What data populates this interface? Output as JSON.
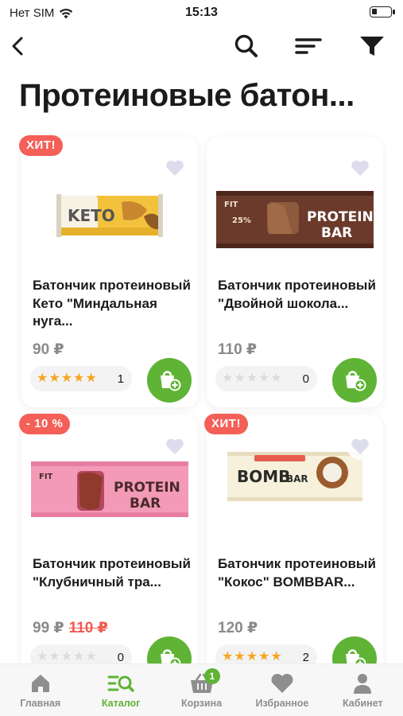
{
  "status_bar": {
    "carrier": "Нет SIM",
    "time": "15:13"
  },
  "nav": {
    "icons": [
      "back-arrow-icon",
      "search-icon",
      "sort-icon",
      "filter-icon"
    ]
  },
  "page": {
    "title": "Протеиновые батон..."
  },
  "colors": {
    "accent": "#5fb335",
    "badge": "#f45f58",
    "star": "#f5a623",
    "old_price": "#f15a50"
  },
  "products": [
    {
      "badge": "ХИТ!",
      "name": "Батончик протеиновый Кето \"Миндальная нуга...",
      "price": "90 ₽",
      "old_price": "",
      "rating": 5,
      "reviews": "1"
    },
    {
      "badge": "",
      "name": "Батончик протеиновый \"Двойной шокола...",
      "price": "110 ₽",
      "old_price": "",
      "rating": 0,
      "reviews": "0"
    },
    {
      "badge": "- 10 %",
      "name": "Батончик протеиновый \"Клубничный тра...",
      "price": "99 ₽",
      "old_price": "110 ₽",
      "rating": 0,
      "reviews": "0"
    },
    {
      "badge": "ХИТ!",
      "name": "Батончик протеиновый \"Кокос\" BOMBBAR...",
      "price": "120 ₽",
      "old_price": "",
      "rating": 5,
      "reviews": "2"
    }
  ],
  "tab_bar": {
    "tabs": [
      {
        "label": "Главная",
        "icon": "home-icon"
      },
      {
        "label": "Каталог",
        "icon": "catalog-search-icon"
      },
      {
        "label": "Корзина",
        "icon": "basket-icon"
      },
      {
        "label": "Избранное",
        "icon": "heart-icon"
      },
      {
        "label": "Кабинет",
        "icon": "profile-icon"
      }
    ],
    "cart_count": "1",
    "active": "Каталог"
  }
}
